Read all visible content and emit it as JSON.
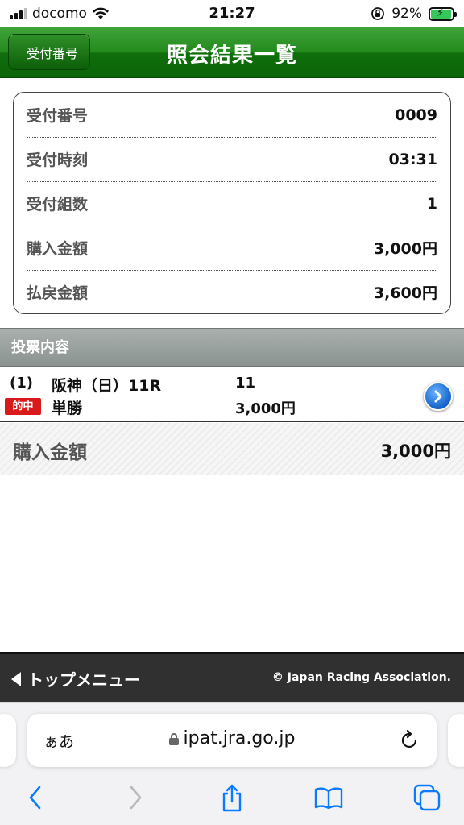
{
  "status_bar": {
    "carrier": "docomo",
    "time": "21:27",
    "battery": "92%"
  },
  "header": {
    "back_label": "受付番号",
    "title": "照会結果一覧"
  },
  "info": {
    "rows": [
      {
        "label": "受付番号",
        "value": "0009"
      },
      {
        "label": "受付時刻",
        "value": "03:31"
      },
      {
        "label": "受付組数",
        "value": "1"
      },
      {
        "label": "購入金額",
        "value": "3,000円"
      },
      {
        "label": "払戻金額",
        "value": "3,600円"
      }
    ]
  },
  "section": {
    "title": "投票内容"
  },
  "vote": {
    "number": "(1)",
    "race": "阪神（日）11R",
    "horse": "11",
    "badge": "的中",
    "type": "単勝",
    "amount": "3,000円"
  },
  "total": {
    "label": "購入金額",
    "value": "3,000円"
  },
  "footer": {
    "top_menu": "トップメニュー",
    "copyright": "© Japan Racing Association."
  },
  "browser": {
    "aa": "ぁあ",
    "url": "ipat.jra.go.jp"
  },
  "colors": {
    "header_green": "#1f8a18",
    "hit_red": "#d91a1a",
    "section_gray": "#9aa19e",
    "footer_dark": "#303030",
    "ios_blue": "#0a7aff"
  }
}
